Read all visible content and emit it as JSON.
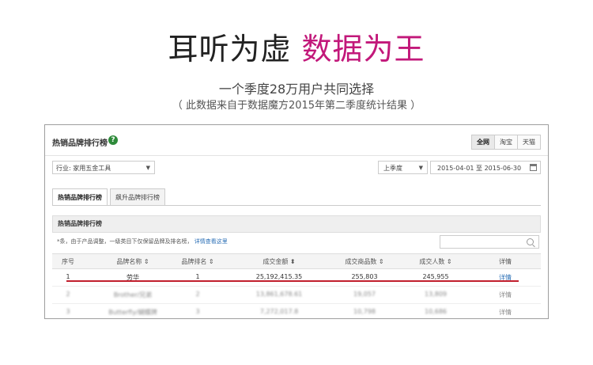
{
  "headline": {
    "part1": "耳听为虚",
    "part2": "数据为王"
  },
  "subtitle": "一个季度28万用户共同选择",
  "source_note": "（ 此数据来自于数据魔方2015年第二季度统计结果 ）",
  "panel": {
    "title": "热销品牌排行榜",
    "help_icon": "question-icon",
    "scope_tabs": [
      "全网",
      "淘宝",
      "天猫"
    ],
    "active_scope": "全网",
    "industry_label": "行业: 家用五金工具",
    "period_label": "上季度",
    "date_range": "2015-04-01 至 2015-06-30",
    "rank_tabs": [
      "热销品牌排行榜",
      "飙升品牌排行榜"
    ],
    "section_title": "热销品牌排行榜",
    "note_text": "*条，由于产品调整，一级类目下仅保留品牌及排名榜，",
    "note_link": "详情查看这里",
    "columns": [
      "序号",
      "品牌名称 ⇕",
      "品牌排名 ⇕",
      "成交金额 ⬍",
      "成交商品数 ⇕",
      "成交人数 ⇕",
      "详情"
    ],
    "rows": [
      {
        "index": "1",
        "brand": "劳华",
        "rank": "1",
        "amount": "25,192,415.35",
        "items": "255,803",
        "buyers": "245,955",
        "detail": "详情"
      },
      {
        "index": "2",
        "brand": "Brother/兄弟",
        "rank": "2",
        "amount": "13,861,678.61",
        "items": "19,057",
        "buyers": "13,809",
        "detail": "详情"
      },
      {
        "index": "3",
        "brand": "Butterfly/蝴蝶牌",
        "rank": "3",
        "amount": "7,272,017.8",
        "items": "10,798",
        "buyers": "10,686",
        "detail": "详情"
      }
    ]
  },
  "colors": {
    "accent_pink": "#c2187a",
    "underline_red": "#c21f2d",
    "link_blue": "#2b6fb6"
  }
}
